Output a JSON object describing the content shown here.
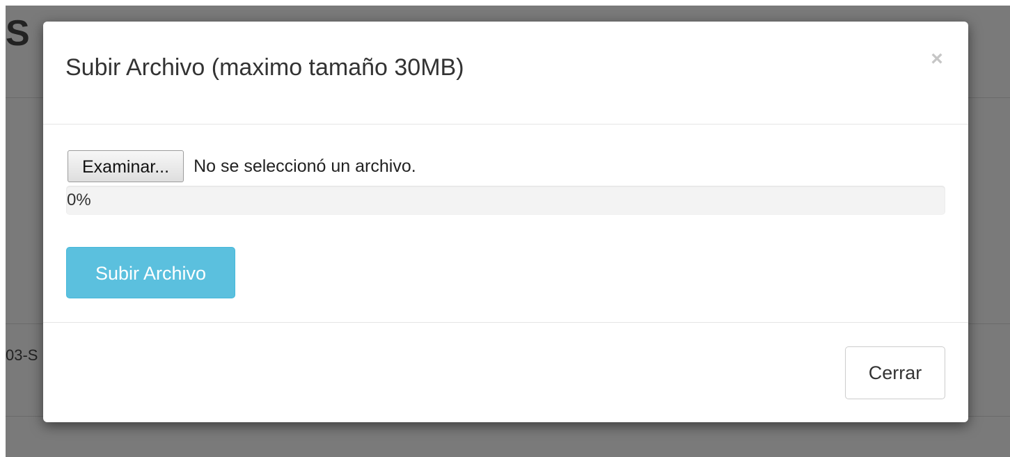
{
  "background": {
    "heading_fragment": "S",
    "cell_fragment": "03-S"
  },
  "modal": {
    "title": "Subir Archivo (maximo tamaño 30MB)",
    "close_symbol": "×",
    "file_input": {
      "button_label": "Examinar...",
      "status_text": "No se seleccionó un archivo."
    },
    "progress": {
      "value_percent": 0,
      "label": "0%",
      "accent_color": "#5bc0de"
    },
    "upload_button_label": "Subir Archivo",
    "footer": {
      "close_button_label": "Cerrar"
    }
  }
}
